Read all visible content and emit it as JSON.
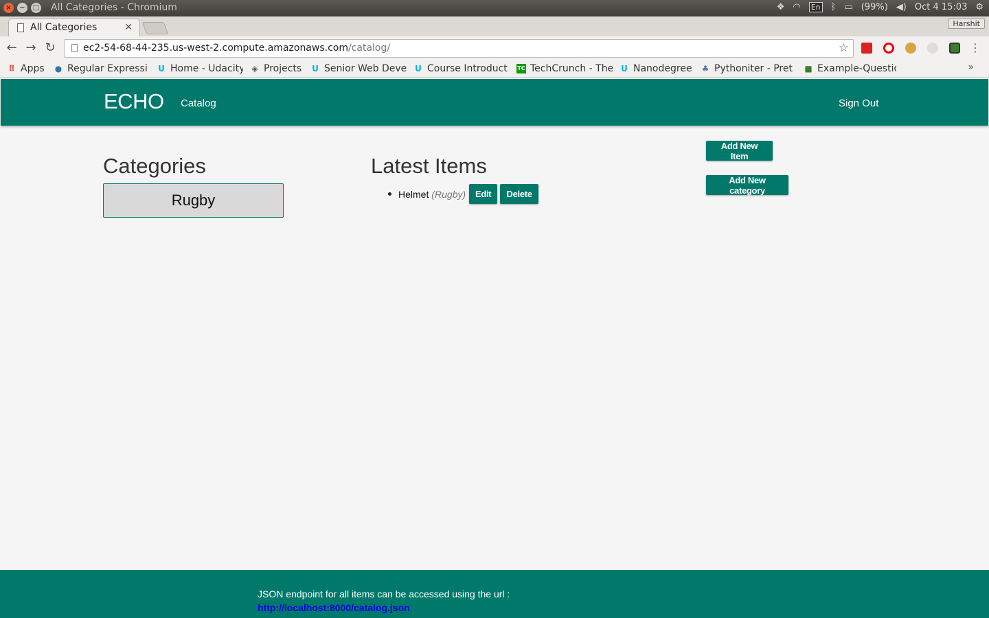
{
  "os": {
    "window_title": "All Categories - Chromium",
    "battery": "(99%)",
    "clock": "Oct 4 15:03",
    "lang": "En"
  },
  "browser": {
    "tab_title": "All Categories",
    "profile": "Harshit",
    "url_host": "ec2-54-68-44-235.us-west-2.compute.amazonaws.com",
    "url_path": "/catalog/",
    "bookmarks": [
      {
        "label": "Apps",
        "icon": "apps-grid-icon",
        "color": "#d44"
      },
      {
        "label": "Regular Expressi",
        "icon": "python-icon",
        "color": "#3776ab"
      },
      {
        "label": "Home - Udacity",
        "icon": "udacity-icon",
        "color": "#02b3e4"
      },
      {
        "label": "Projects",
        "icon": "shield-icon",
        "color": "#555"
      },
      {
        "label": "Senior Web Deve",
        "icon": "udacity-icon",
        "color": "#02b3e4"
      },
      {
        "label": "Course Introduct",
        "icon": "udacity-icon",
        "color": "#02b3e4"
      },
      {
        "label": "TechCrunch - The",
        "icon": "techcrunch-icon",
        "color": "#0a9e01"
      },
      {
        "label": "Nanodegree",
        "icon": "udacity-icon",
        "color": "#02b3e4"
      },
      {
        "label": "Pythoniter - Pret",
        "icon": "pythoniter-icon",
        "color": "#5577aa"
      },
      {
        "label": "Example-Questic",
        "icon": "leaf-icon",
        "color": "#3a7d2a"
      }
    ]
  },
  "navbar": {
    "brand": "ECHO",
    "catalog": "Catalog",
    "sign_out": "Sign Out"
  },
  "categories": {
    "heading": "Categories",
    "items": [
      "Rugby"
    ]
  },
  "latest": {
    "heading": "Latest Items",
    "items": [
      {
        "name": "Helmet",
        "category": "(Rugby)",
        "edit": "Edit",
        "delete": "Delete"
      }
    ]
  },
  "actions": {
    "add_item": "Add New Item",
    "add_category": "Add New category"
  },
  "footer": {
    "text": "JSON endpoint for all items can be accessed using the url :",
    "link": "http://localhost:8000/catalog.json"
  },
  "colors": {
    "primary": "#00796b",
    "background": "#f5f5f5"
  }
}
